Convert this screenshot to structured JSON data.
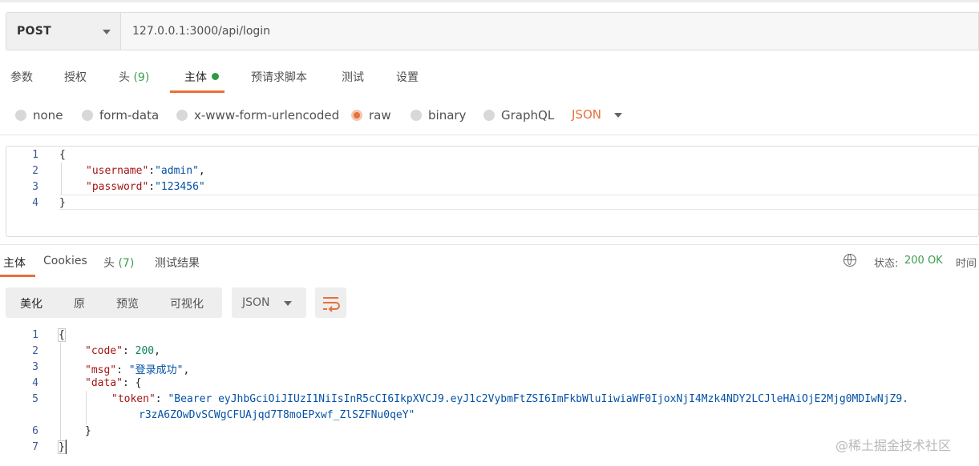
{
  "request": {
    "method": "POST",
    "url": "127.0.0.1:3000/api/login"
  },
  "request_tabs": {
    "params": "参数",
    "auth": "授权",
    "headers": "头",
    "headers_count": "(9)",
    "body": "主体",
    "prerequest": "预请求脚本",
    "tests": "测试",
    "settings": "设置"
  },
  "body_types": {
    "none": "none",
    "form_data": "form-data",
    "urlencoded": "x-www-form-urlencoded",
    "raw": "raw",
    "binary": "binary",
    "graphql": "GraphQL",
    "format": "JSON",
    "selected": "raw"
  },
  "request_body": {
    "line_numbers": [
      "1",
      "2",
      "3",
      "4"
    ],
    "open_brace": "{",
    "close_brace": "}",
    "username_key": "\"username\"",
    "username_value": "\"admin\"",
    "password_key": "\"password\"",
    "password_value": "\"123456\""
  },
  "response_tabs": {
    "body": "主体",
    "cookies": "Cookies",
    "headers": "头",
    "headers_count": "(7)",
    "test_results": "测试结果"
  },
  "response_status": {
    "status_label": "状态:",
    "status_value": "200 OK",
    "time_label": "时间"
  },
  "response_view": {
    "pretty": "美化",
    "raw": "原",
    "preview": "预览",
    "visualize": "可视化",
    "format": "JSON"
  },
  "response_body": {
    "line_numbers": [
      "1",
      "2",
      "3",
      "4",
      "5",
      "6",
      "7"
    ],
    "open_brace": "{",
    "close_brace": "}",
    "code_key": "\"code\"",
    "code_value": "200",
    "msg_key": "\"msg\"",
    "msg_value": "\"登录成功\"",
    "data_key": "\"data\"",
    "token_key": "\"token\"",
    "token_value_line1": "\"Bearer eyJhbGciOiJIUzI1NiIsInR5cCI6IkpXVCJ9.eyJ1c2VybmFtZSI6ImFkbWluIiwiaWF0IjoxNjI4Mzk4NDY2LCJleHAiOjE2Mjg0MDIwNjZ9.",
    "token_value_line2": "r3zA6ZOwDvSCWgCFUAjqd7T8moEPxwf_ZlSZFNu0qeY\""
  },
  "watermark": "@稀土掘金技术社区",
  "colors": {
    "accent": "#e8703a",
    "success": "#3a9e4d",
    "json_key": "#a31515",
    "json_string": "#0451a5",
    "json_number": "#098658"
  }
}
